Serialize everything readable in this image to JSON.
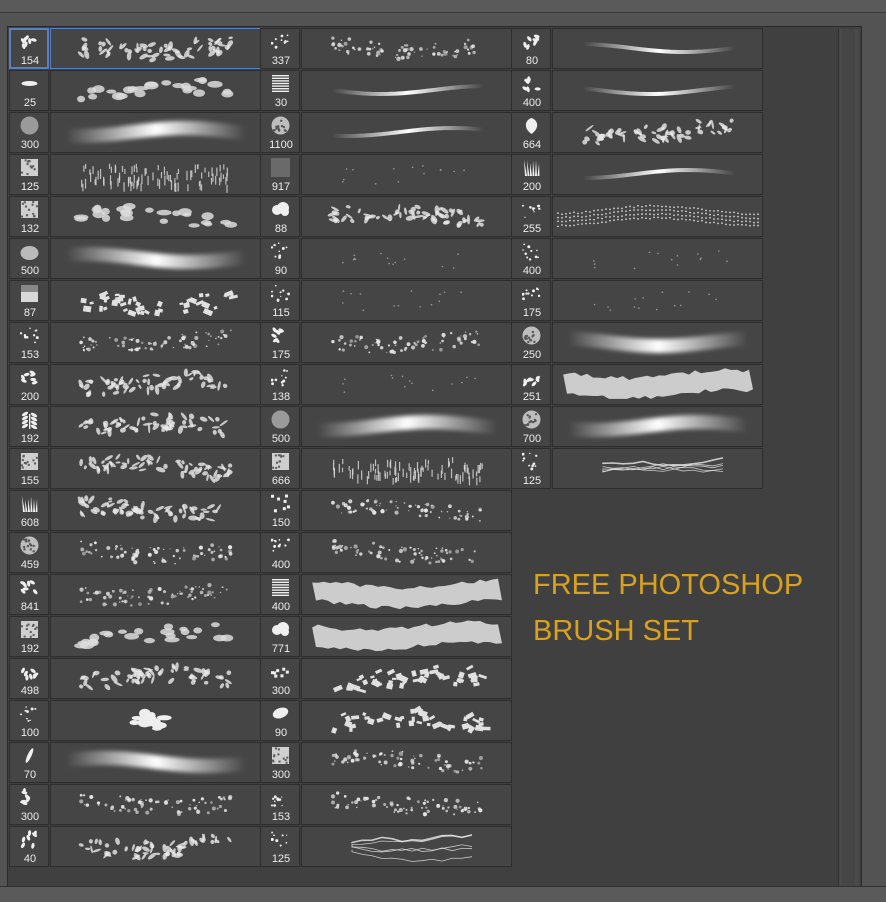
{
  "caption": {
    "line1": "FREE PHOTOSHOP",
    "line2": "BRUSH SET"
  },
  "colors": {
    "accent": "#d8a21f",
    "selection": "#5c7fbf",
    "panel_bg": "#404040",
    "cell_bg": "#454545"
  },
  "brush_columns": [
    {
      "selected_index": 0,
      "brushes": [
        {
          "size": "154",
          "icon": "leaf-cluster-icon",
          "stroke": "leafy-band"
        },
        {
          "size": "25",
          "icon": "flat-oval-icon",
          "stroke": "dabs"
        },
        {
          "size": "300",
          "icon": "round-soft-icon",
          "stroke": "soft-wide"
        },
        {
          "size": "125",
          "icon": "square-texture-icon",
          "stroke": "grass-block"
        },
        {
          "size": "132",
          "icon": "square-texture-icon",
          "stroke": "dabs"
        },
        {
          "size": "500",
          "icon": "soft-blob-icon",
          "stroke": "soft-wide"
        },
        {
          "size": "87",
          "icon": "gradient-square-icon",
          "stroke": "chips"
        },
        {
          "size": "153",
          "icon": "scatter-dots-icon",
          "stroke": "speckle"
        },
        {
          "size": "200",
          "icon": "leaf-cluster-icon",
          "stroke": "leafy-band"
        },
        {
          "size": "192",
          "icon": "leaf-sprig-icon",
          "stroke": "leafy-band"
        },
        {
          "size": "155",
          "icon": "square-texture-icon",
          "stroke": "leafy-band"
        },
        {
          "size": "608",
          "icon": "grass-tuft-icon",
          "stroke": "leafy-band"
        },
        {
          "size": "459",
          "icon": "round-texture-icon",
          "stroke": "speckle"
        },
        {
          "size": "841",
          "icon": "leaf-cluster-icon",
          "stroke": "speckle"
        },
        {
          "size": "192",
          "icon": "square-texture-icon",
          "stroke": "dabs"
        },
        {
          "size": "498",
          "icon": "leaf-cluster-icon",
          "stroke": "leafy-band"
        },
        {
          "size": "100",
          "icon": "scatter-dots-icon",
          "stroke": "blob"
        },
        {
          "size": "70",
          "icon": "feather-icon",
          "stroke": "soft-wide"
        },
        {
          "size": "300",
          "icon": "leaf-cluster-icon",
          "stroke": "speckle"
        },
        {
          "size": "40",
          "icon": "leaf-cluster-icon",
          "stroke": "leafy-band"
        }
      ]
    },
    {
      "selected_index": -1,
      "brushes": [
        {
          "size": "337",
          "icon": "scatter-dots-icon",
          "stroke": "speckle"
        },
        {
          "size": "30",
          "icon": "hair-lines-icon",
          "stroke": "streak"
        },
        {
          "size": "1100",
          "icon": "round-texture-icon",
          "stroke": "streak"
        },
        {
          "size": "917",
          "icon": "gray-square-icon",
          "stroke": "faint"
        },
        {
          "size": "88",
          "icon": "cloud-icon",
          "stroke": "leafy-band"
        },
        {
          "size": "90",
          "icon": "scatter-dots-icon",
          "stroke": "faint"
        },
        {
          "size": "115",
          "icon": "scatter-dots-icon",
          "stroke": "faint"
        },
        {
          "size": "175",
          "icon": "leaf-cluster-icon",
          "stroke": "speckle"
        },
        {
          "size": "138",
          "icon": "scatter-dots-icon",
          "stroke": "faint"
        },
        {
          "size": "500",
          "icon": "round-soft-icon",
          "stroke": "soft-wide"
        },
        {
          "size": "666",
          "icon": "square-texture-icon",
          "stroke": "grass-block"
        },
        {
          "size": "150",
          "icon": "scatter-squares-icon",
          "stroke": "speckle"
        },
        {
          "size": "400",
          "icon": "scatter-dots-icon",
          "stroke": "speckle"
        },
        {
          "size": "400",
          "icon": "hair-lines-icon",
          "stroke": "wide-rough"
        },
        {
          "size": "771",
          "icon": "cloud-icon",
          "stroke": "wide-rough"
        },
        {
          "size": "300",
          "icon": "scatter-squares-icon",
          "stroke": "chips"
        },
        {
          "size": "90",
          "icon": "blob-icon",
          "stroke": "chips"
        },
        {
          "size": "300",
          "icon": "square-texture-icon",
          "stroke": "speckle"
        },
        {
          "size": "153",
          "icon": "scatter-dots-icon",
          "stroke": "speckle"
        },
        {
          "size": "125",
          "icon": "scatter-dots-icon",
          "stroke": "lightning"
        }
      ]
    },
    {
      "selected_index": -1,
      "brushes": [
        {
          "size": "80",
          "icon": "leaf-cluster-icon",
          "stroke": "streak"
        },
        {
          "size": "400",
          "icon": "leaf-cluster-icon",
          "stroke": "streak"
        },
        {
          "size": "664",
          "icon": "leaf-shape-icon",
          "stroke": "leafy-band"
        },
        {
          "size": "200",
          "icon": "grass-tuft-icon",
          "stroke": "streak"
        },
        {
          "size": "255",
          "icon": "scatter-dots-icon",
          "stroke": "dotted-bands"
        },
        {
          "size": "400",
          "icon": "scatter-dots-icon",
          "stroke": "faint"
        },
        {
          "size": "175",
          "icon": "scatter-dots-icon",
          "stroke": "faint"
        },
        {
          "size": "250",
          "icon": "round-texture-icon",
          "stroke": "soft-wide"
        },
        {
          "size": "251",
          "icon": "leaf-cluster-icon",
          "stroke": "wide-rough"
        },
        {
          "size": "700",
          "icon": "round-texture-icon",
          "stroke": "soft-wide"
        },
        {
          "size": "125",
          "icon": "scatter-dots-icon",
          "stroke": "lightning"
        }
      ]
    }
  ]
}
